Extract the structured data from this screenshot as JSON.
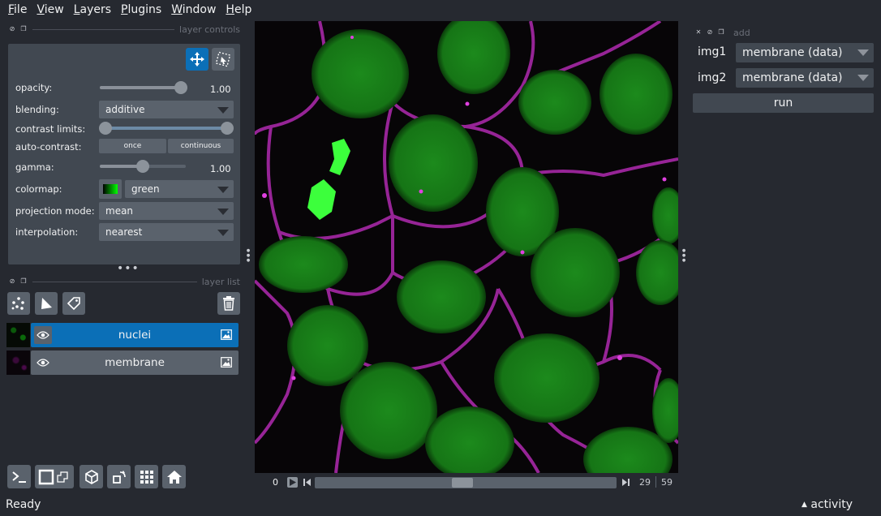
{
  "menu": [
    "File",
    "View",
    "Layers",
    "Plugins",
    "Window",
    "Help"
  ],
  "menu_mnemonics": [
    "F",
    "V",
    "L",
    "P",
    "W",
    "H"
  ],
  "menu_rest": [
    "ile",
    "iew",
    "ayers",
    "lugins",
    "indow",
    "elp"
  ],
  "dock_left_top": {
    "title": "layer controls"
  },
  "dock_left_bottom": {
    "title": "layer list"
  },
  "dock_right": {
    "title": "add"
  },
  "controls": {
    "opacity_label": "opacity:",
    "opacity_value": "1.00",
    "opacity_level": 1.0,
    "blending_label": "blending:",
    "blending_value": "additive",
    "contrast_label": "contrast limits:",
    "contrast_range": [
      0.0,
      1.0
    ],
    "autocontrast_label": "auto-contrast:",
    "once_label": "once",
    "continuous_label": "continuous",
    "gamma_label": "gamma:",
    "gamma_value": "1.00",
    "gamma_level": 0.5,
    "colormap_label": "colormap:",
    "colormap_value": "green",
    "projection_label": "projection mode:",
    "projection_value": "mean",
    "interpolation_label": "interpolation:",
    "interpolation_value": "nearest"
  },
  "layers": [
    {
      "name": "nuclei",
      "selected": true
    },
    {
      "name": "membrane",
      "selected": false
    }
  ],
  "dims": {
    "start": "0",
    "current": "29",
    "total": "59",
    "level": 0.49
  },
  "widget": {
    "img1_label": "img1",
    "img1_value": "membrane (data)",
    "img2_label": "img2",
    "img2_value": "membrane (data)",
    "run_label": "run"
  },
  "status": "Ready",
  "activity": "activity",
  "colors": {
    "accent": "#0b6fb7",
    "bg": "#262930",
    "panel": "#414851",
    "button": "#5a626c"
  }
}
